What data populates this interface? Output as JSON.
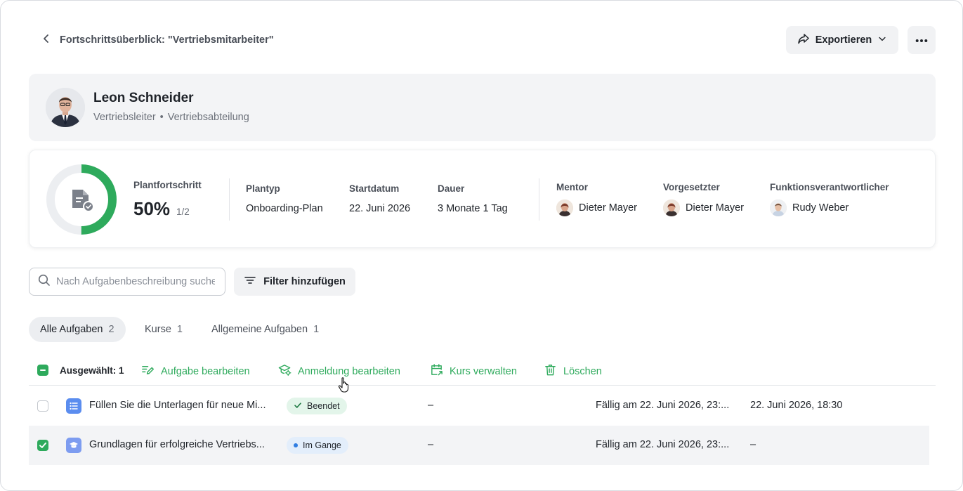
{
  "header": {
    "back_title": "Fortschrittsüberblick: \"Vertriebsmitarbeiter\"",
    "export_label": "Exportieren"
  },
  "profile": {
    "name": "Leon Schneider",
    "role": "Vertriebsleiter",
    "separator": "•",
    "department": "Vertriebsabteilung"
  },
  "stats": {
    "progress_label": "Plantfortschritt",
    "progress_value": "50%",
    "progress_fraction": 0.5,
    "progress_count": "1/2",
    "plantyp_label": "Plantyp",
    "plantyp_value": "Onboarding-Plan",
    "start_label": "Startdatum",
    "start_value": "22. Juni 2026",
    "dauer_label": "Dauer",
    "dauer_value": "3 Monate 1 Tag",
    "mentor_label": "Mentor",
    "mentor_value": "Dieter Mayer",
    "vorgesetzter_label": "Vorgesetzter",
    "vorgesetzter_value": "Dieter Mayer",
    "funktion_label": "Funktionsverantwortlicher",
    "funktion_value": "Rudy Weber"
  },
  "search": {
    "placeholder": "Nach Aufgabenbeschreibung suchen",
    "filter_label": "Filter hinzufügen"
  },
  "tabs": [
    {
      "label": "Alle Aufgaben",
      "count": "2"
    },
    {
      "label": "Kurse",
      "count": "1"
    },
    {
      "label": "Allgemeine Aufgaben",
      "count": "1"
    }
  ],
  "actions": {
    "selected_label": "Ausgewählt: 1",
    "edit_task": "Aufgabe bearbeiten",
    "edit_enrollment": "Anmeldung bearbeiten",
    "manage_course": "Kurs verwalten",
    "delete": "Löschen"
  },
  "rows": [
    {
      "title": "Füllen Sie die Unterlagen für neue Mi...",
      "status": "Beendet",
      "col3": "–",
      "due": "Fällig am 22. Juni 2026, 23:...",
      "completed": "22. Juni 2026, 18:30"
    },
    {
      "title": "Grundlagen für erfolgreiche Vertriebs...",
      "status": "Im Gange",
      "col3": "–",
      "due": "Fällig am 22. Juni 2026, 23:...",
      "completed": "–"
    }
  ],
  "colors": {
    "accent": "#2eaa5c",
    "in_progress_dot": "#2f7de1",
    "task_icon_bg": "#5b8def",
    "course_icon_bg": "#7d9cf0"
  },
  "icons": [
    "chevron-left-icon",
    "share-icon",
    "chevron-down-icon",
    "more-dots-icon",
    "document-check-icon",
    "search-icon",
    "filter-lines-icon",
    "edit-lines-icon",
    "graduation-settings-icon",
    "calendar-export-icon",
    "trash-icon",
    "list-icon",
    "graduation-cap-icon",
    "check-icon",
    "hand-cursor-icon"
  ]
}
